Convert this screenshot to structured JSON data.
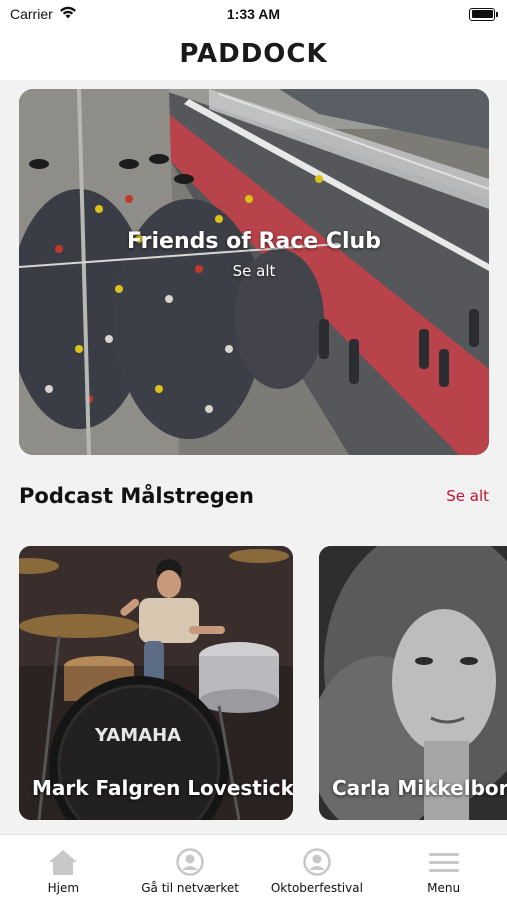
{
  "status_bar": {
    "carrier": "Carrier",
    "time": "1:33 AM",
    "battery_level": 1.0
  },
  "header": {
    "title": "PADDOCK"
  },
  "hero": {
    "title": "Friends of Race Club",
    "link_label": "Se alt"
  },
  "podcast_section": {
    "title": "Podcast Målstregen",
    "link_label": "Se alt",
    "link_color": "#c8102e",
    "cards": [
      {
        "label": "Mark Falgren Lovestick",
        "drum_brand": "YAMAHA"
      },
      {
        "label": "Carla Mikkelborg"
      }
    ]
  },
  "tab_bar": {
    "items": [
      {
        "label": "Hjem",
        "icon": "home-icon"
      },
      {
        "label": "Gå til netværket",
        "icon": "user-circle-icon"
      },
      {
        "label": "Oktoberfestival",
        "icon": "user-circle-icon"
      },
      {
        "label": "Menu",
        "icon": "hamburger-menu-icon"
      }
    ]
  }
}
